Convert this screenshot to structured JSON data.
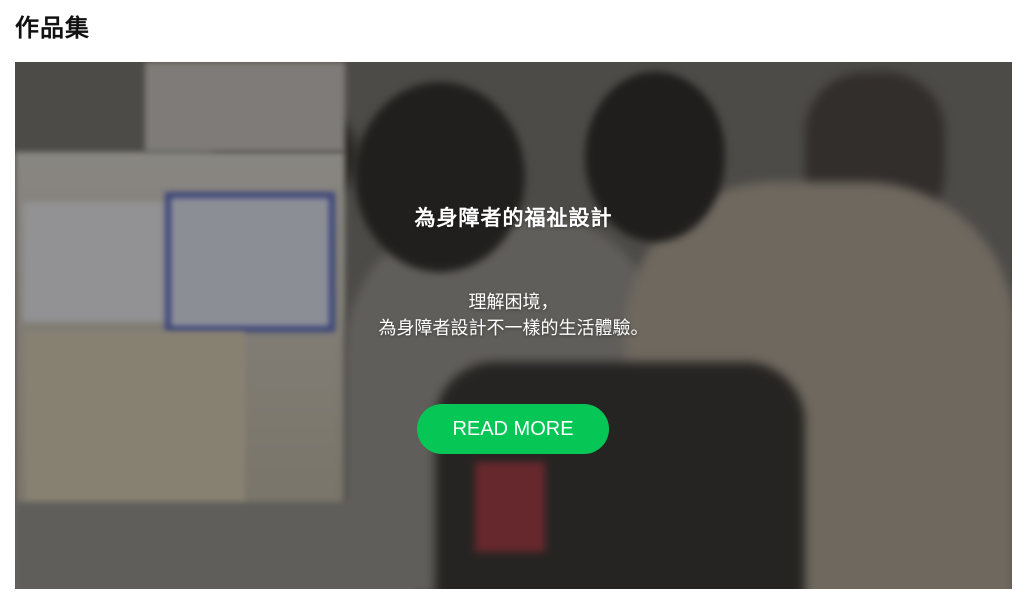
{
  "page": {
    "title": "作品集"
  },
  "card": {
    "title": "為身障者的福祉設計",
    "description_lines": [
      "理解困境，",
      "為身障者設計不一樣的生活體驗。"
    ],
    "button_label": "READ MORE",
    "button_color": "#06c755",
    "image_subject": "blurred photo of people helping a wheelchair user at a train station ticket machine"
  }
}
